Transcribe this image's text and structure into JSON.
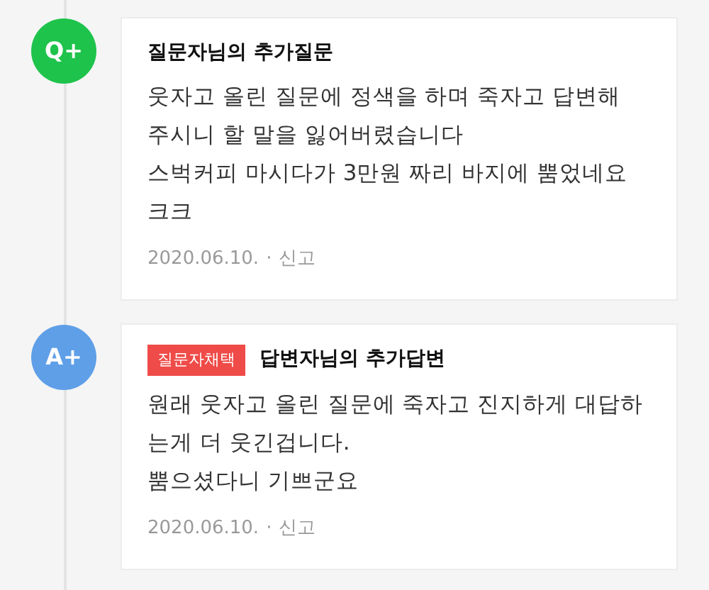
{
  "entries": [
    {
      "kind": "question",
      "avatar": "Q+",
      "title": "질문자님의 추가질문",
      "lines": [
        "웃자고 올린 질문에 정색을 하며 죽자고 답변해",
        "주시니 할 말을 잃어버렸습니다",
        "스벅커피 마시다가 3만원 짜리 바지에 뿜었네요",
        "크크"
      ],
      "date": "2020.06.10.",
      "separator": "·",
      "report": "신고"
    },
    {
      "kind": "answer",
      "avatar": "A+",
      "badge": "질문자채택",
      "title": "답변자님의 추가답변",
      "lines": [
        "원래 웃자고 올린 질문에 죽자고 진지하게 대답하",
        "는게 더 웃긴겁니다.",
        "뿜으셨다니 기쁘군요"
      ],
      "date": "2020.06.10.",
      "separator": "·",
      "report": "신고"
    }
  ]
}
